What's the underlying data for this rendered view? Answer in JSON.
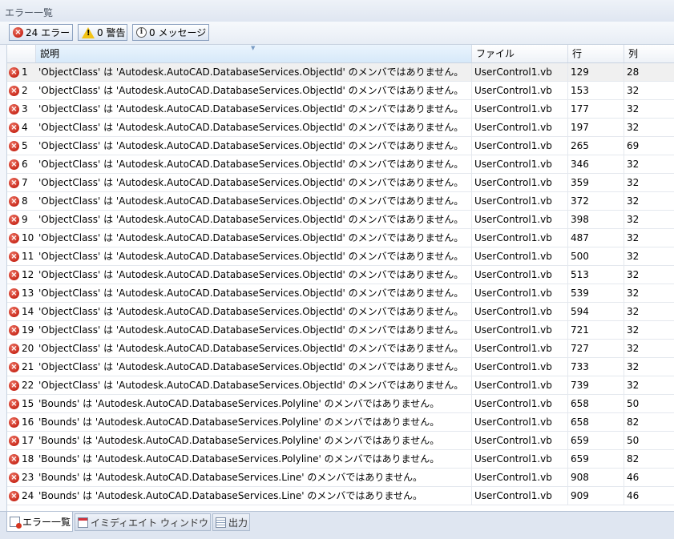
{
  "window": {
    "title": "エラー一覧"
  },
  "toolbar": {
    "errors_label": "24 エラー",
    "warnings_label": "0 警告",
    "messages_label": "0 メッセージ"
  },
  "columns": {
    "description": "説明",
    "file": "ファイル",
    "line": "行",
    "column": "列"
  },
  "rows": [
    {
      "num": "1",
      "desc": "'ObjectClass' は 'Autodesk.AutoCAD.DatabaseServices.ObjectId' のメンバではありません。",
      "file": "UserControl1.vb",
      "line": "129",
      "col": "28"
    },
    {
      "num": "2",
      "desc": "'ObjectClass' は 'Autodesk.AutoCAD.DatabaseServices.ObjectId' のメンバではありません。",
      "file": "UserControl1.vb",
      "line": "153",
      "col": "32"
    },
    {
      "num": "3",
      "desc": "'ObjectClass' は 'Autodesk.AutoCAD.DatabaseServices.ObjectId' のメンバではありません。",
      "file": "UserControl1.vb",
      "line": "177",
      "col": "32"
    },
    {
      "num": "4",
      "desc": "'ObjectClass' は 'Autodesk.AutoCAD.DatabaseServices.ObjectId' のメンバではありません。",
      "file": "UserControl1.vb",
      "line": "197",
      "col": "32"
    },
    {
      "num": "5",
      "desc": "'ObjectClass' は 'Autodesk.AutoCAD.DatabaseServices.ObjectId' のメンバではありません。",
      "file": "UserControl1.vb",
      "line": "265",
      "col": "69"
    },
    {
      "num": "6",
      "desc": "'ObjectClass' は 'Autodesk.AutoCAD.DatabaseServices.ObjectId' のメンバではありません。",
      "file": "UserControl1.vb",
      "line": "346",
      "col": "32"
    },
    {
      "num": "7",
      "desc": "'ObjectClass' は 'Autodesk.AutoCAD.DatabaseServices.ObjectId' のメンバではありません。",
      "file": "UserControl1.vb",
      "line": "359",
      "col": "32"
    },
    {
      "num": "8",
      "desc": "'ObjectClass' は 'Autodesk.AutoCAD.DatabaseServices.ObjectId' のメンバではありません。",
      "file": "UserControl1.vb",
      "line": "372",
      "col": "32"
    },
    {
      "num": "9",
      "desc": "'ObjectClass' は 'Autodesk.AutoCAD.DatabaseServices.ObjectId' のメンバではありません。",
      "file": "UserControl1.vb",
      "line": "398",
      "col": "32"
    },
    {
      "num": "10",
      "desc": "'ObjectClass' は 'Autodesk.AutoCAD.DatabaseServices.ObjectId' のメンバではありません。",
      "file": "UserControl1.vb",
      "line": "487",
      "col": "32"
    },
    {
      "num": "11",
      "desc": "'ObjectClass' は 'Autodesk.AutoCAD.DatabaseServices.ObjectId' のメンバではありません。",
      "file": "UserControl1.vb",
      "line": "500",
      "col": "32"
    },
    {
      "num": "12",
      "desc": "'ObjectClass' は 'Autodesk.AutoCAD.DatabaseServices.ObjectId' のメンバではありません。",
      "file": "UserControl1.vb",
      "line": "513",
      "col": "32"
    },
    {
      "num": "13",
      "desc": "'ObjectClass' は 'Autodesk.AutoCAD.DatabaseServices.ObjectId' のメンバではありません。",
      "file": "UserControl1.vb",
      "line": "539",
      "col": "32"
    },
    {
      "num": "14",
      "desc": "'ObjectClass' は 'Autodesk.AutoCAD.DatabaseServices.ObjectId' のメンバではありません。",
      "file": "UserControl1.vb",
      "line": "594",
      "col": "32"
    },
    {
      "num": "19",
      "desc": "'ObjectClass' は 'Autodesk.AutoCAD.DatabaseServices.ObjectId' のメンバではありません。",
      "file": "UserControl1.vb",
      "line": "721",
      "col": "32"
    },
    {
      "num": "20",
      "desc": "'ObjectClass' は 'Autodesk.AutoCAD.DatabaseServices.ObjectId' のメンバではありません。",
      "file": "UserControl1.vb",
      "line": "727",
      "col": "32"
    },
    {
      "num": "21",
      "desc": "'ObjectClass' は 'Autodesk.AutoCAD.DatabaseServices.ObjectId' のメンバではありません。",
      "file": "UserControl1.vb",
      "line": "733",
      "col": "32"
    },
    {
      "num": "22",
      "desc": "'ObjectClass' は 'Autodesk.AutoCAD.DatabaseServices.ObjectId' のメンバではありません。",
      "file": "UserControl1.vb",
      "line": "739",
      "col": "32"
    },
    {
      "num": "15",
      "desc": "'Bounds' は 'Autodesk.AutoCAD.DatabaseServices.Polyline' のメンバではありません。",
      "file": "UserControl1.vb",
      "line": "658",
      "col": "50"
    },
    {
      "num": "16",
      "desc": "'Bounds' は 'Autodesk.AutoCAD.DatabaseServices.Polyline' のメンバではありません。",
      "file": "UserControl1.vb",
      "line": "658",
      "col": "82"
    },
    {
      "num": "17",
      "desc": "'Bounds' は 'Autodesk.AutoCAD.DatabaseServices.Polyline' のメンバではありません。",
      "file": "UserControl1.vb",
      "line": "659",
      "col": "50"
    },
    {
      "num": "18",
      "desc": "'Bounds' は 'Autodesk.AutoCAD.DatabaseServices.Polyline' のメンバではありません。",
      "file": "UserControl1.vb",
      "line": "659",
      "col": "82"
    },
    {
      "num": "23",
      "desc": "'Bounds' は 'Autodesk.AutoCAD.DatabaseServices.Line' のメンバではありません。",
      "file": "UserControl1.vb",
      "line": "908",
      "col": "46"
    },
    {
      "num": "24",
      "desc": "'Bounds' は 'Autodesk.AutoCAD.DatabaseServices.Line' のメンバではありません。",
      "file": "UserControl1.vb",
      "line": "909",
      "col": "46"
    }
  ],
  "tabs": [
    {
      "label": "エラー一覧",
      "icon": "error-list-icon"
    },
    {
      "label": "イミディエイト ウィンドウ",
      "icon": "immediate-window-icon"
    },
    {
      "label": "出力",
      "icon": "output-icon"
    }
  ],
  "colors": {
    "error": "#c8281a",
    "warning": "#f3c315",
    "header_bg": "#eef2f7",
    "panel_bg": "#dfe6f1"
  }
}
